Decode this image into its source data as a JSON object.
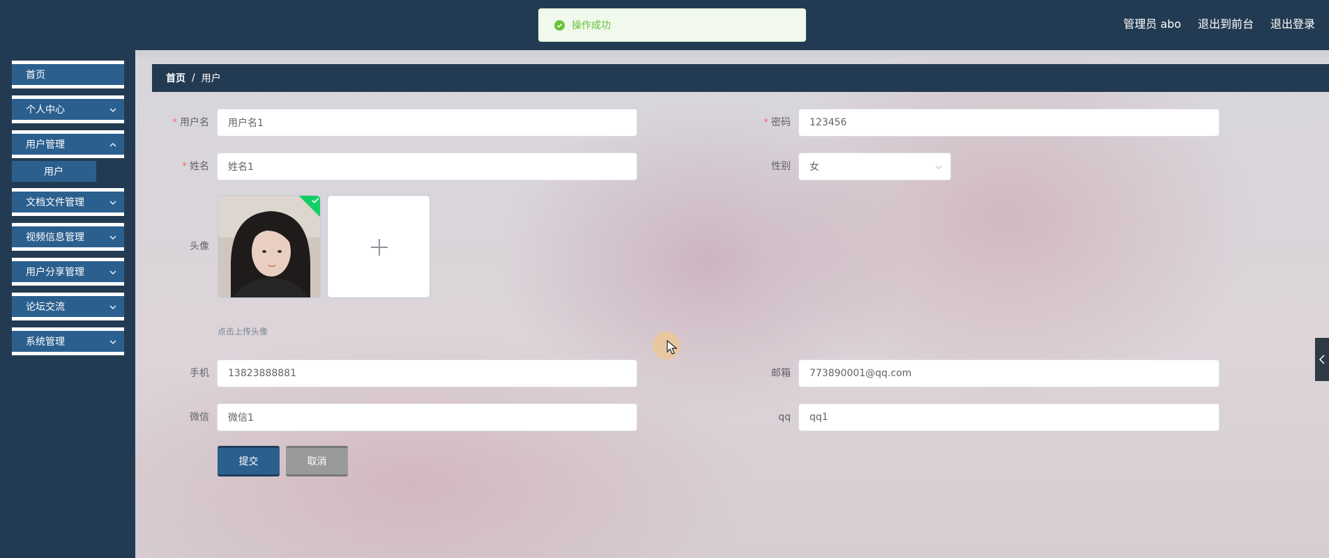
{
  "header": {
    "admin_label": "管理员 abo",
    "frontend_link": "退出到前台",
    "logout_link": "退出登录"
  },
  "toast": {
    "message": "操作成功"
  },
  "sidebar": {
    "items": [
      {
        "label": "首页"
      },
      {
        "label": "个人中心"
      },
      {
        "label": "用户管理"
      },
      {
        "label": "文档文件管理"
      },
      {
        "label": "视频信息管理"
      },
      {
        "label": "用户分享管理"
      },
      {
        "label": "论坛交流"
      },
      {
        "label": "系统管理"
      }
    ],
    "submenu": {
      "label": "用户"
    }
  },
  "breadcrumb": {
    "home": "首页",
    "separator": "/",
    "current": "用户"
  },
  "form": {
    "username": {
      "label": "用户名",
      "value": "用户名1"
    },
    "password": {
      "label": "密码",
      "value": "123456"
    },
    "name": {
      "label": "姓名",
      "value": "姓名1"
    },
    "gender": {
      "label": "性别",
      "value": "女"
    },
    "avatar": {
      "label": "头像",
      "hint": "点击上传头像"
    },
    "phone": {
      "label": "手机",
      "value": "13823888881"
    },
    "email": {
      "label": "邮箱",
      "value": "773890001@qq.com"
    },
    "wechat": {
      "label": "微信",
      "value": "微信1"
    },
    "qq": {
      "label": "qq",
      "value": "qq1"
    },
    "required_mark": "*"
  },
  "buttons": {
    "submit": "提交",
    "cancel": "取消"
  },
  "colors": {
    "nav_bg": "#233b52",
    "menu_bg": "#2b5f8e",
    "success": "#67c23a",
    "required": "#f56c6c"
  }
}
